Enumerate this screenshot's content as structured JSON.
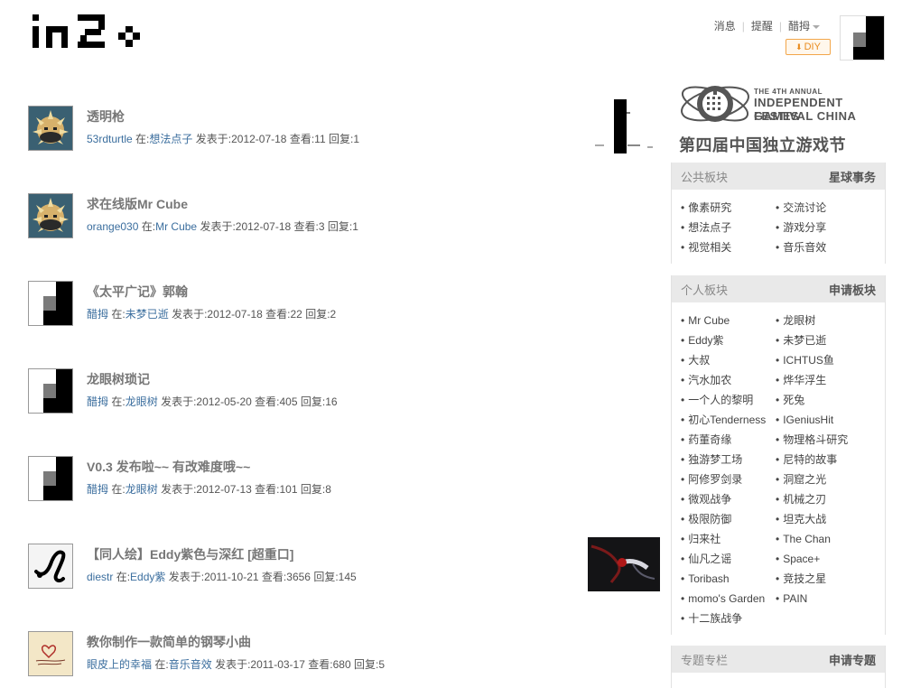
{
  "header": {
    "logo_alt": "in2o",
    "nav": {
      "messages": "消息",
      "reminders": "提醒",
      "user": "醋拇"
    },
    "diy_label": "DIY"
  },
  "posts": [
    {
      "title": "透明枪",
      "author": "53rdturtle",
      "in_label": "在:",
      "board": "想法点子",
      "posted_label": "发表于:",
      "date": "2012-07-18",
      "views_label": "查看:",
      "views": "11",
      "replies_label": "回复:",
      "replies": "1",
      "avatar": "spiky-ball",
      "thumbnail": true
    },
    {
      "title": "求在线版Mr Cube",
      "author": "orange030",
      "in_label": "在:",
      "board": "Mr Cube",
      "posted_label": "发表于:",
      "date": "2012-07-18",
      "views_label": "查看:",
      "views": "3",
      "replies_label": "回复:",
      "replies": "1",
      "avatar": "spiky-ball",
      "thumbnail": false
    },
    {
      "title": "《太平广记》郭翰",
      "author": "醋拇",
      "in_label": "在:",
      "board": "未梦已逝",
      "posted_label": "发表于:",
      "date": "2012-07-18",
      "views_label": "查看:",
      "views": "22",
      "replies_label": "回复:",
      "replies": "2",
      "avatar": "block",
      "thumbnail": false
    },
    {
      "title": "龙眼树琐记",
      "author": "醋拇",
      "in_label": "在:",
      "board": "龙眼树",
      "posted_label": "发表于:",
      "date": "2012-05-20",
      "views_label": "查看:",
      "views": "405",
      "replies_label": "回复:",
      "replies": "16",
      "avatar": "block",
      "thumbnail": false
    },
    {
      "title": "V0.3 发布啦~~ 有改难度哦~~",
      "author": "醋拇",
      "in_label": "在:",
      "board": "龙眼树",
      "posted_label": "发表于:",
      "date": "2012-07-13",
      "views_label": "查看:",
      "views": "101",
      "replies_label": "回复:",
      "replies": "8",
      "avatar": "block",
      "thumbnail": false
    },
    {
      "title": "【同人绘】Eddy紫色与深红 [超重口]",
      "author": "diestr",
      "in_label": "在:",
      "board": "Eddy紫",
      "posted_label": "发表于:",
      "date": "2011-10-21",
      "views_label": "查看:",
      "views": "3656",
      "replies_label": "回复:",
      "replies": "145",
      "avatar": "sketch",
      "thumbnail": true
    },
    {
      "title": "教你制作一款简单的钢琴小曲",
      "author": "眼皮上的幸福",
      "in_label": "在:",
      "board": "音乐音效",
      "posted_label": "发表于:",
      "date": "2011-03-17",
      "views_label": "查看:",
      "views": "680",
      "replies_label": "回复:",
      "replies": "5",
      "avatar": "heart-note",
      "thumbnail": false
    }
  ],
  "banner": {
    "line1": "THE 4TH ANNUAL",
    "line2": "INDEPENDENT GAMES",
    "line3": "FESTIVAL CHINA",
    "line4": "第四届中国独立游戏节"
  },
  "public_boards": {
    "label": "公共板块",
    "action": "星球事务",
    "items": [
      "像素研究",
      "交流讨论",
      "想法点子",
      "游戏分享",
      "视觉相关",
      "音乐音效"
    ]
  },
  "personal_boards": {
    "label": "个人板块",
    "action": "申请板块",
    "items": [
      "Mr Cube",
      "龙眼树",
      "Eddy紫",
      "未梦已逝",
      "大叔",
      "ICHTUS鱼",
      "汽水加农",
      "烨华浮生",
      "一个人的黎明",
      "死兔",
      "初心Tenderness",
      "IGeniusHit",
      "药董奇缘",
      "物理格斗研究",
      "独游梦工场",
      "尼特的故事",
      "阿修罗剑录",
      "洞窟之光",
      "微观战争",
      "机械之刃",
      "极限防御",
      "坦克大战",
      "归来社",
      "The Chan",
      "仙凡之谣",
      "Space+",
      "Toribash",
      "竞技之星",
      "momo's Garden",
      "PAIN",
      "十二族战争"
    ]
  },
  "columns": {
    "label": "专题专栏",
    "action": "申请专题"
  }
}
